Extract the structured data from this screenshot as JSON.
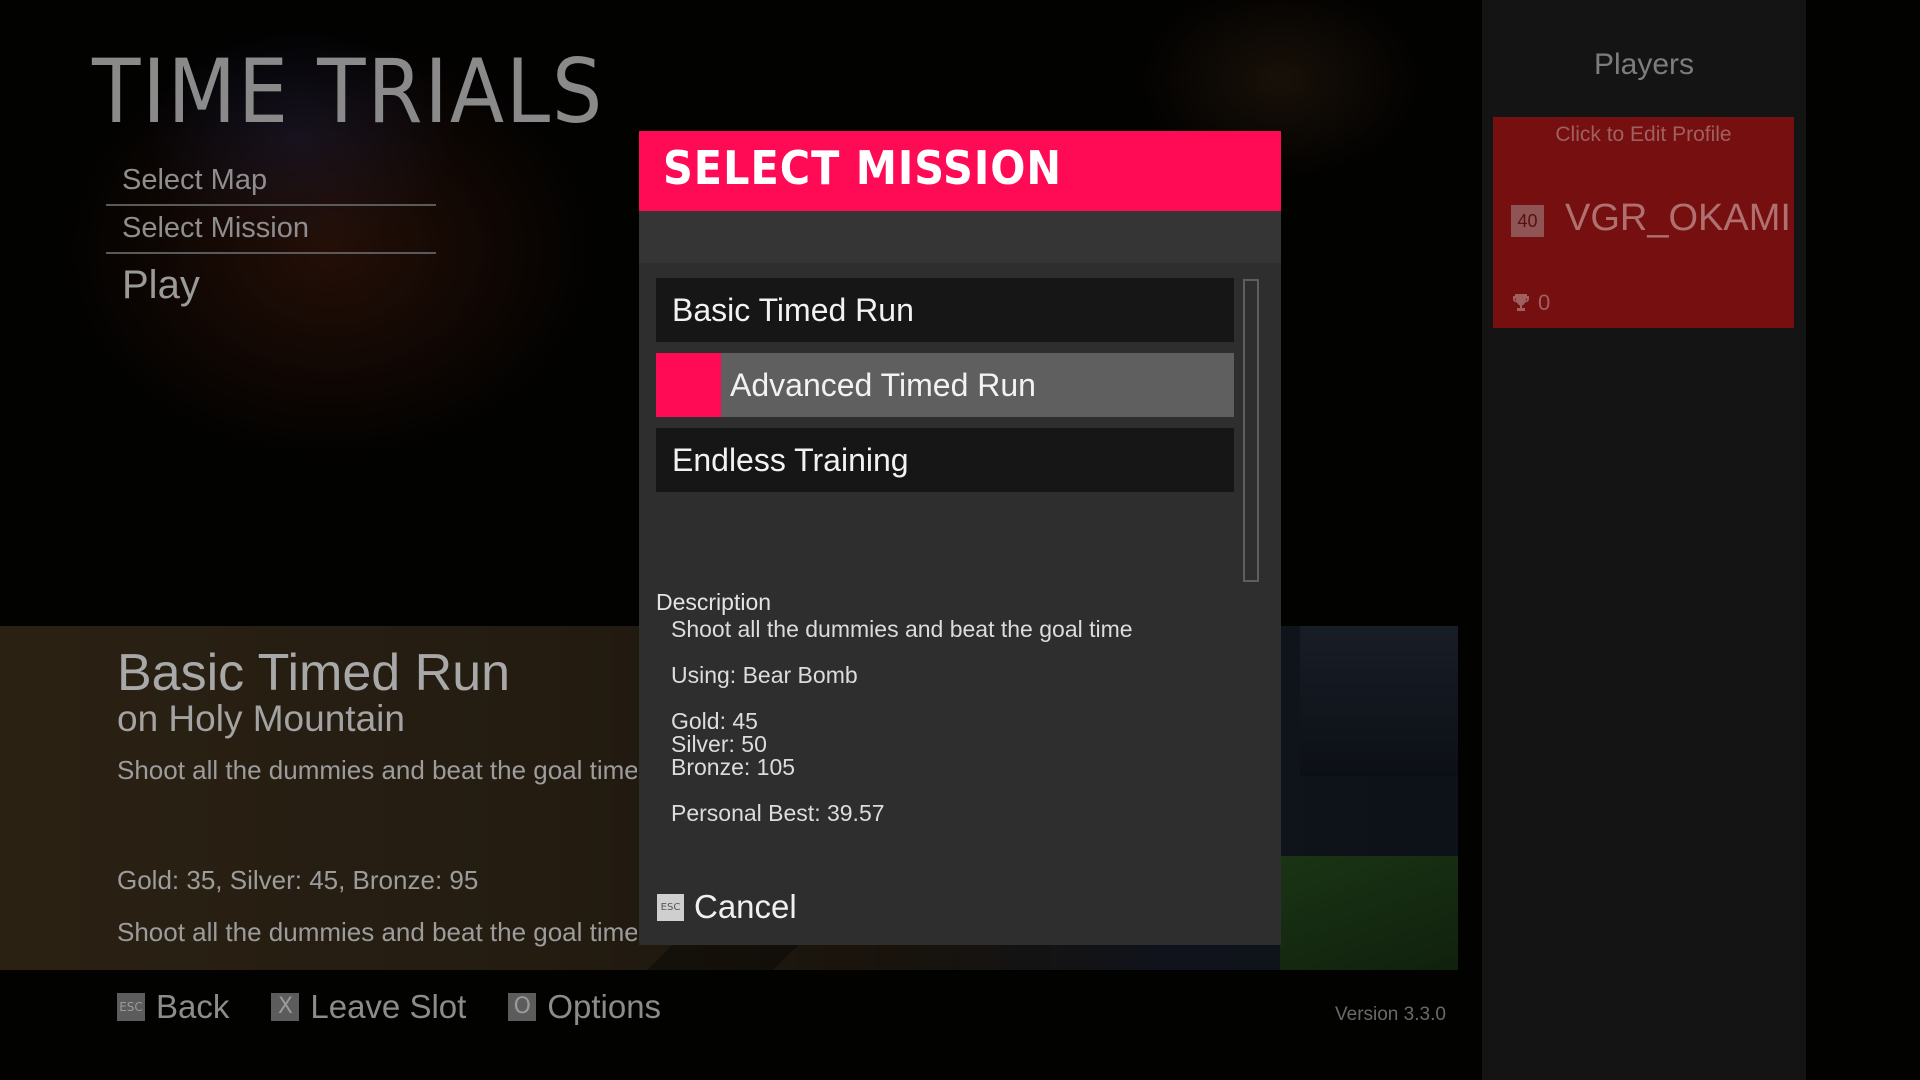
{
  "page": {
    "title": "TIME TRIALS"
  },
  "left_menu": {
    "items": [
      "Select Map",
      "Select Mission"
    ],
    "play_label": "Play"
  },
  "preview": {
    "mission_title": "Basic Timed Run",
    "map_line": "on Holy Mountain",
    "description": "Shoot all the dummies and beat the goal time",
    "medals": "Gold: 35, Silver: 45, Bronze: 95",
    "description_repeat": "Shoot all the dummies and beat the goal time"
  },
  "bottom_bar": {
    "back": {
      "key": "ESC",
      "label": "Back"
    },
    "leave_slot": {
      "key": "X",
      "label": "Leave Slot"
    },
    "options": {
      "key": "O",
      "label": "Options"
    }
  },
  "version": "Version 3.3.0",
  "players": {
    "heading": "Players",
    "card": {
      "edit_hint": "Click to Edit Profile",
      "level": "40",
      "name": "VGR_OKAMI",
      "trophies": "0",
      "trophy_icon": "trophy-icon"
    },
    "card_color": "#760f0f"
  },
  "dialog": {
    "title": "SELECT MISSION",
    "accent_color": "#ff0a55",
    "missions": [
      {
        "label": "Basic Timed Run",
        "selected": false
      },
      {
        "label": "Advanced Timed Run",
        "selected": true
      },
      {
        "label": "Endless Training",
        "selected": false
      }
    ],
    "description": {
      "heading": "Description",
      "text": "Shoot all the dummies and beat the goal time",
      "using": "Using: Bear Bomb",
      "gold": "Gold: 45",
      "silver": "Silver: 50",
      "bronze": "Bronze: 105",
      "personal_best": "Personal Best: 39.57"
    },
    "cancel": {
      "key": "ESC",
      "label": "Cancel"
    }
  }
}
